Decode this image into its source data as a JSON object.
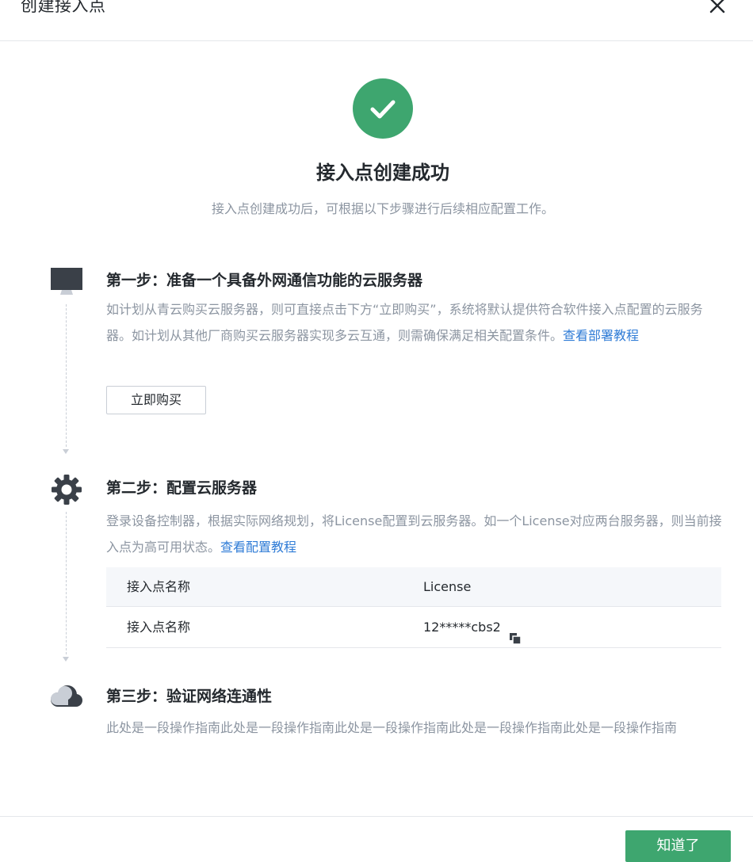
{
  "dialog": {
    "title": "创建接入点",
    "close_icon": "close-icon"
  },
  "success": {
    "icon": "check-circle-icon",
    "icon_color": "#3ea66f",
    "title": "接入点创建成功",
    "subtitle": "接入点创建成功后，可根据以下步骤进行后续相应配置工作。"
  },
  "steps": [
    {
      "icon": "monitor-icon",
      "title": "第一步：准备一个具备外网通信功能的云服务器",
      "text": "如计划从青云购买云服务器，则可直接点击下方“立即购买”，系统将默认提供符合软件接入点配置的云服务器。如计划从其他厂商购买云服务器实现多云互通，则需确保满足相关配置条件。",
      "link": "查看部署教程",
      "button": "立即购买"
    },
    {
      "icon": "gear-icon",
      "title": "第二步：配置云服务器",
      "text": "登录设备控制器，根据实际网络规划，将License配置到云服务器。如一个License对应两台服务器，则当前接入点为高可用状态。",
      "link": "查看配置教程",
      "table": {
        "columns": [
          "接入点名称",
          "License"
        ],
        "rows": [
          [
            "接入点名称",
            "12*****cbs2"
          ]
        ],
        "copy_icon": "copy-icon"
      }
    },
    {
      "icon": "cloud-icon",
      "title": "第三步：验证网络连通性",
      "text": "此处是一段操作指南此处是一段操作指南此处是一段操作指南此处是一段操作指南此处是一段操作指南"
    }
  ],
  "footer": {
    "ok_button": "知道了"
  },
  "colors": {
    "accent": "#3ea66f",
    "link": "#2e7bd6",
    "muted_text": "#8c95a1"
  }
}
